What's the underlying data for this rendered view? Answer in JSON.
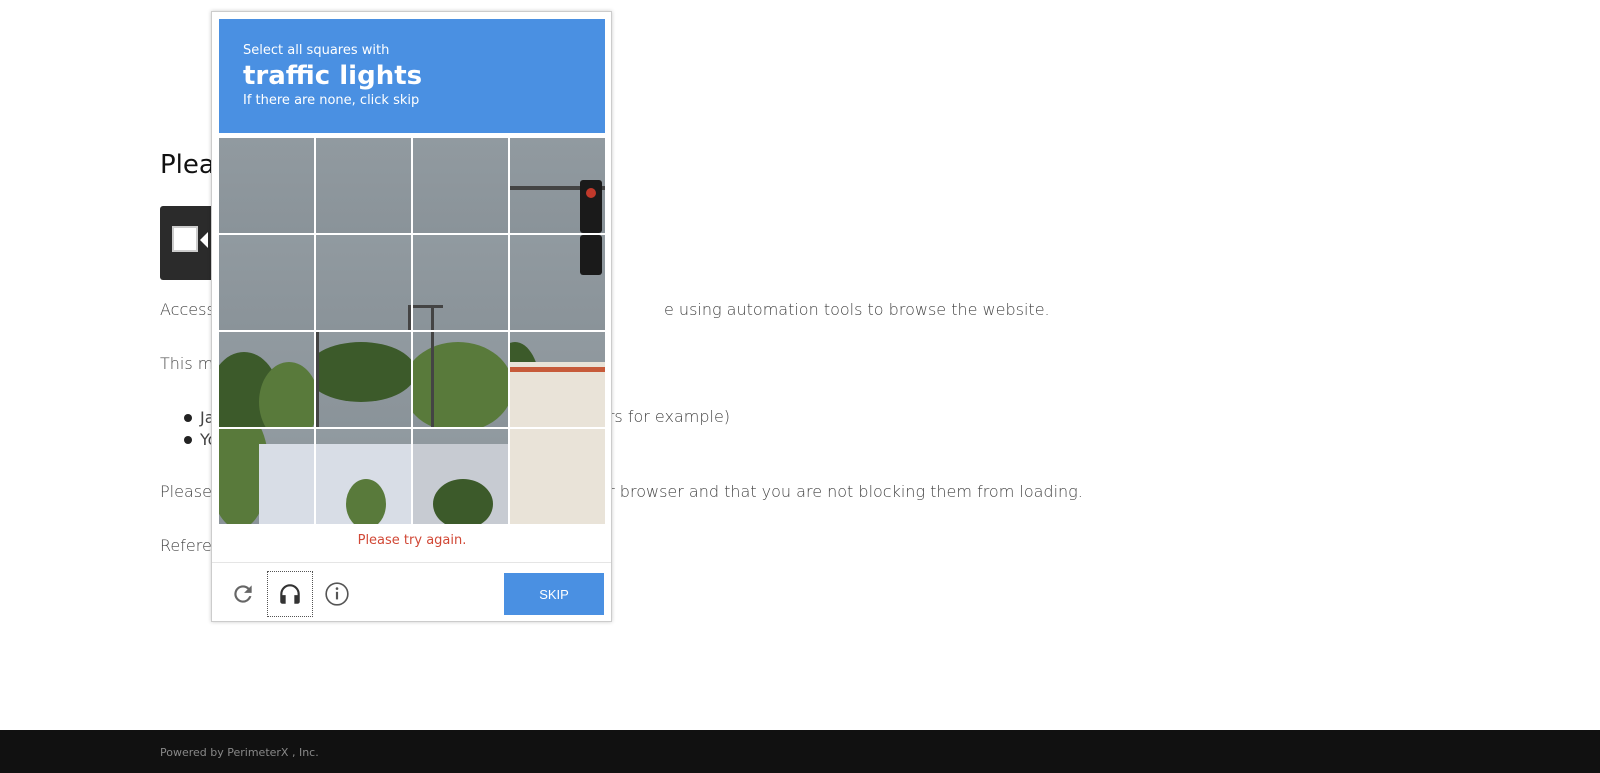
{
  "page": {
    "heading": "Pleas",
    "access_text": "Access",
    "access_text_tail": "e using automation tools to browse the website.",
    "this_text": "This ma",
    "list_items": [
      {
        "start": "Ja",
        "tail": "ers for example)"
      },
      {
        "start": "Yo",
        "tail": ""
      }
    ],
    "please_text": "Please",
    "please_tail": "ur browser and that you are not blocking them from loading.",
    "reference_text": "Referen"
  },
  "footer": {
    "powered_by": "Powered by PerimeterX , Inc."
  },
  "captcha": {
    "instruction": "Select all squares with",
    "target": "traffic lights",
    "hint": "If there are none, click skip",
    "error": "Please try again.",
    "skip_label": "SKIP",
    "grid_rows": 4,
    "grid_cols": 4,
    "icons": [
      "reload-icon",
      "headphones-icon",
      "info-icon"
    ],
    "colors": {
      "header_bg": "#4a90e2",
      "error": "#d14836",
      "skip_bg": "#4a90e2"
    }
  }
}
